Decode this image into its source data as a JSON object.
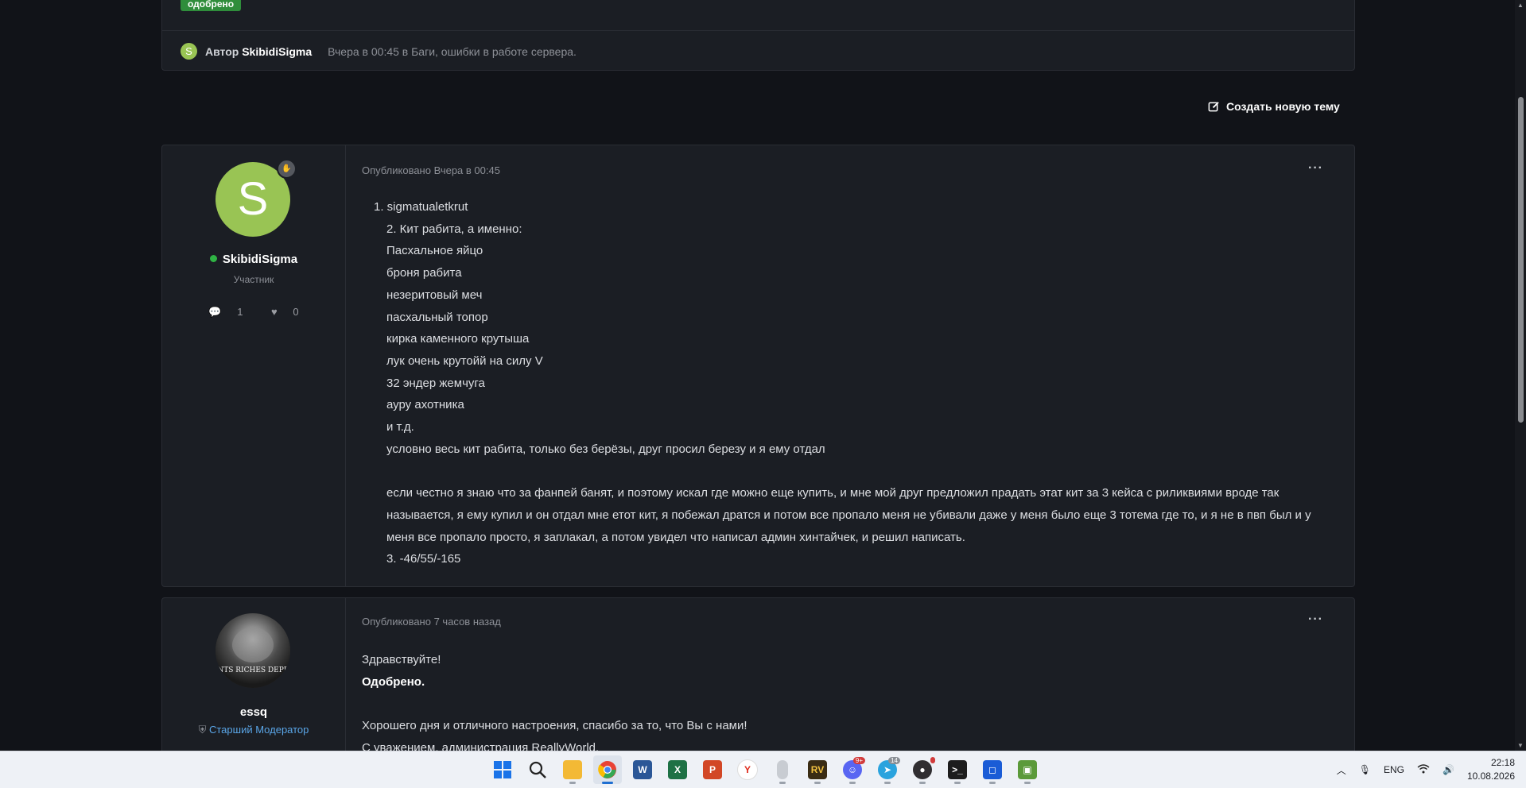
{
  "top_card": {
    "badge": "одобрено",
    "avatar_letter": "S",
    "author_prefix": "Автор",
    "author": "SkibidiSigma",
    "meta": "Вчера в 00:45 в Баги, ошибки в работе сервера."
  },
  "create_topic_label": "Создать новую тему",
  "post1": {
    "avatar_letter": "S",
    "username": "SkibidiSigma",
    "role": "Участник",
    "posts_count": "1",
    "likes_count": "0",
    "published": "Опубликовано Вчера в 00:45",
    "more": "···",
    "lines": [
      "1. sigmatualetkrut",
      "2. Кит рабита, а именно:",
      "Пасхальное яйцо",
      "броня рабита",
      "незеритовый меч",
      "пасхальный топор",
      "кирка каменного крутыша",
      "лук очень крутойй на силу V",
      "32 эндер жемчуга",
      "ауру ахотника",
      "и т.д.",
      "условно весь кит рабита, только без берёзы, друг просил березу и я ему отдал",
      "",
      "если честно я знаю что за фанпей банят, и поэтому искал где можно еще купить, и мне мой друг предложил прадать этат кит за 3 кейса с риликвиями вроде так",
      "называется, я ему купил и он отдал мне етот кит, я побежал дратся и потом все пропало меня не убивали даже у меня было еще 3 тотема где то, и я не в пвп был и у",
      "меня все пропало просто, я заплакал, а потом увидел что написал админ хинтайчек, и решил написать.",
      "3. -46/55/-165"
    ]
  },
  "post2": {
    "username": "essq",
    "role": "Старший Модератор",
    "avatar_text": "ENFANTS RICHES DEPRIMES",
    "published": "Опубликовано 7 часов назад",
    "more": "···",
    "greeting": "Здравствуйте!",
    "verdict": "Одобрено.",
    "wish": "Хорошего дня и отличного настроения, спасибо за то, что Вы с нами!",
    "signature": "С уважением, администрация ReallyWorld."
  },
  "taskbar": {
    "icons": [
      "windows-start",
      "search",
      "file-explorer",
      "chrome",
      "word",
      "excel",
      "powerpoint",
      "yandex-browser",
      "mouse-app",
      "rv-app",
      "discord",
      "telegram",
      "obs",
      "terminal",
      "roblox-app",
      "minecraft"
    ],
    "discord_badge": "9+",
    "telegram_badge": "14",
    "language": "ENG",
    "time": "22:18",
    "date": "10.08.2026"
  }
}
